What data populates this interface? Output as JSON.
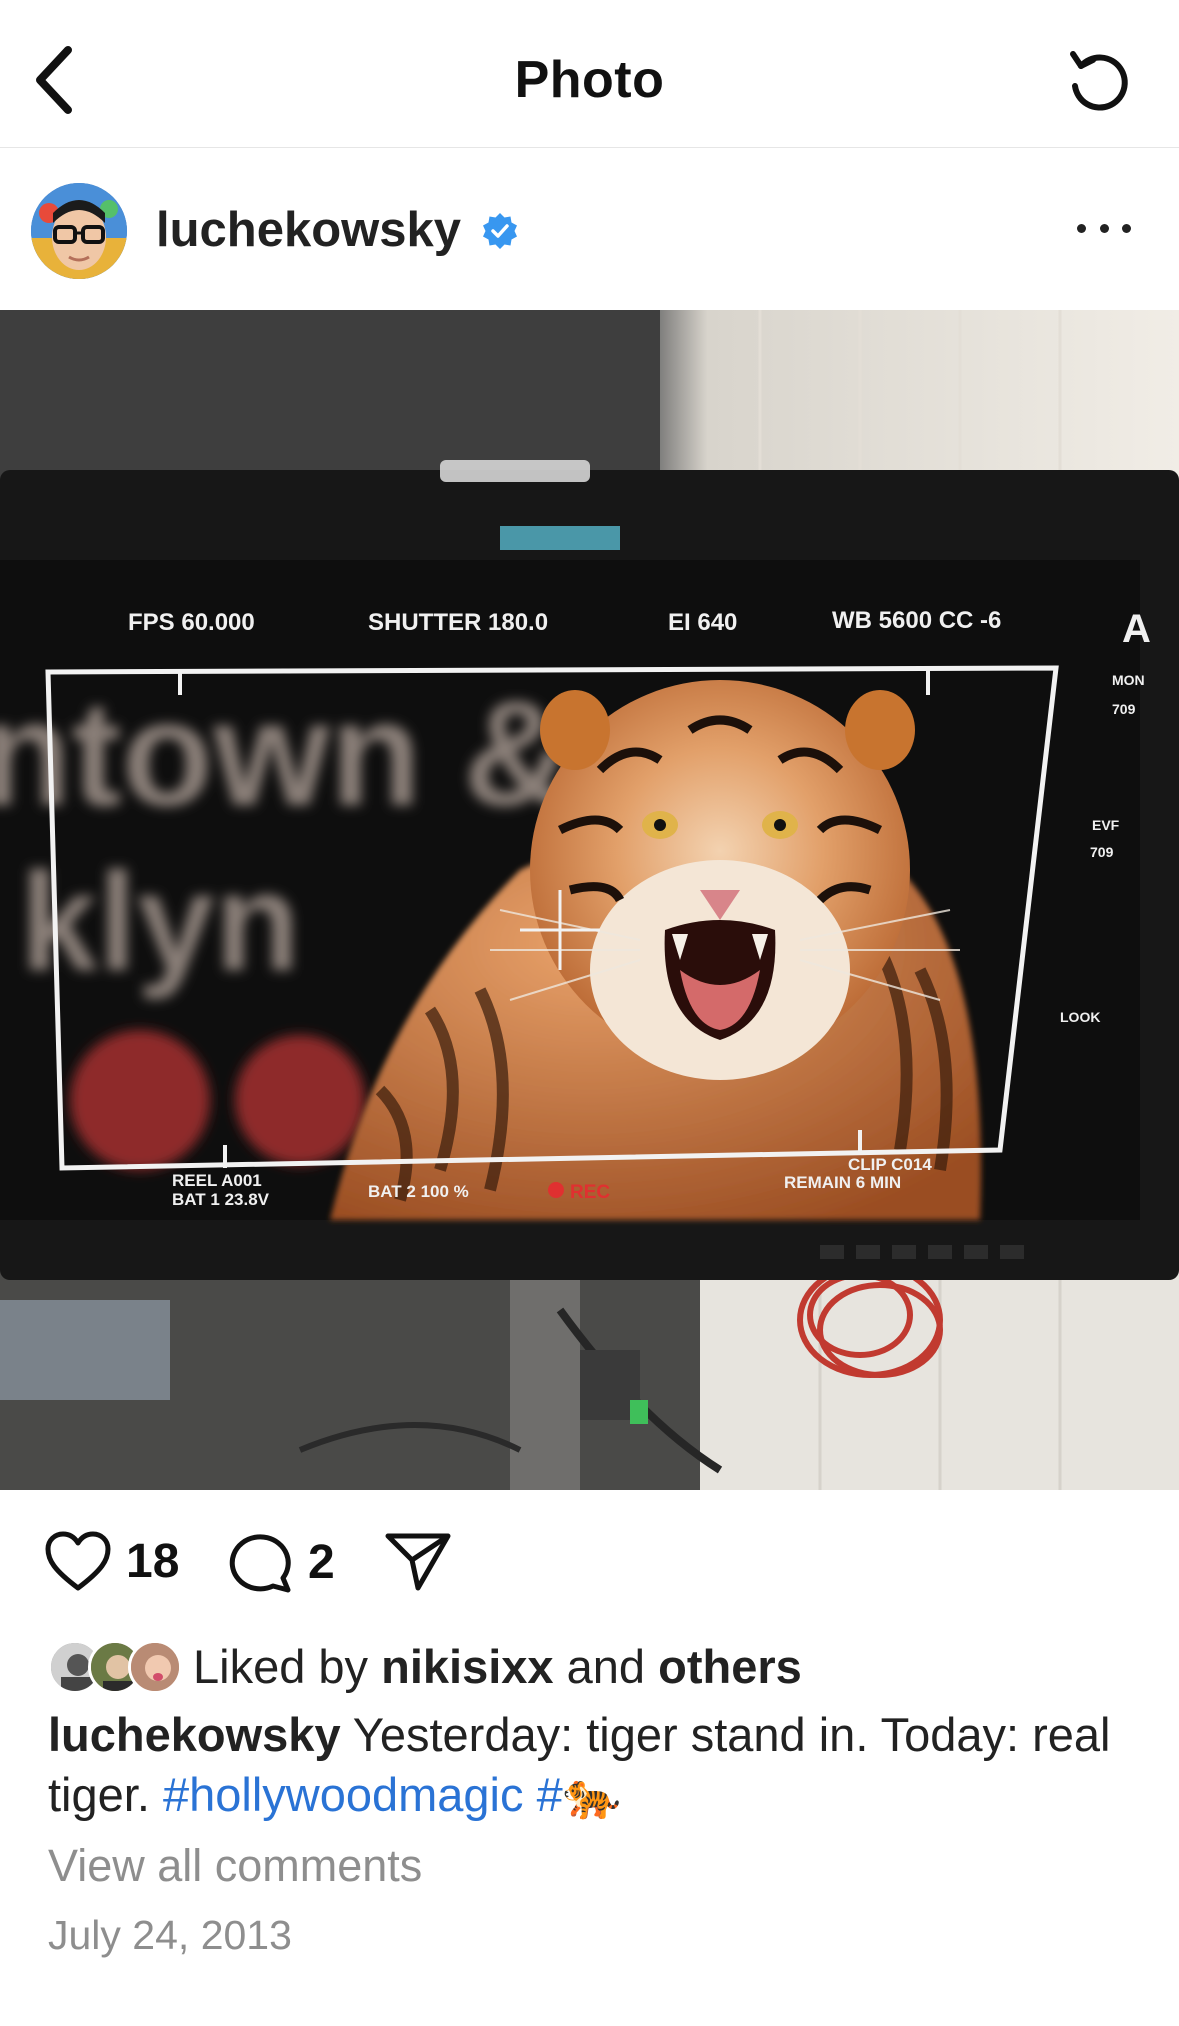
{
  "header": {
    "title": "Photo"
  },
  "post": {
    "username": "luchekowsky",
    "verified": true,
    "photo": {
      "monitor_overlay": {
        "fps": "FPS 60.000",
        "shutter": "SHUTTER 180.0",
        "ei": "EI 640",
        "wb": "WB 5600 CC -6",
        "a": "A",
        "mon": "MON",
        "mon_val": "709",
        "evf": "EVF",
        "evf_val": "709",
        "look": "LOOK",
        "reel": "REEL A001",
        "bat1": "BAT 1 23.8V",
        "bat2": "BAT 2 100 %",
        "rec": "REC",
        "clip": "CLIP C014",
        "remain": "REMAIN 6 MIN",
        "bg_text_1": "ntown &",
        "bg_text_2": "klyn"
      }
    },
    "likes_count": "18",
    "comments_count": "2",
    "liked_by_prefix": "Liked by",
    "liked_by_user": "nikisixx",
    "liked_by_and": "and",
    "liked_by_others": "others",
    "caption_user": "luchekowsky",
    "caption_text": " Yesterday: tiger stand in. Today: real tiger. ",
    "hashtag_1": "#hollywoodmagic",
    "hashtag_2": "#🐅",
    "view_comments": "View all comments",
    "date": "July 24, 2013"
  },
  "colors": {
    "link": "#2a73d5",
    "muted": "#8e8e8e",
    "verified": "#3897f0"
  }
}
